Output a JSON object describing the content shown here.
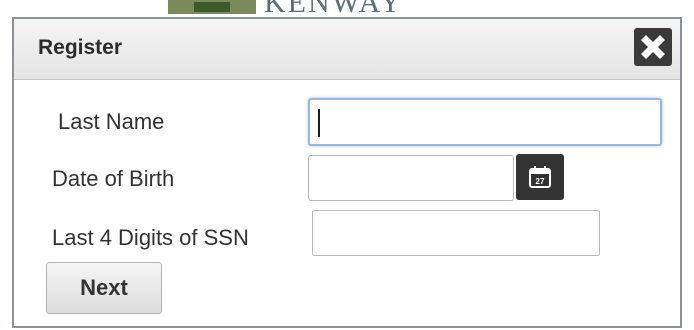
{
  "background": {
    "logo": {
      "wordmark": "KENWAY",
      "icon": "brand-logo-icon"
    }
  },
  "dialog": {
    "title": "Register",
    "close_icon": "close-icon",
    "fields": {
      "last_name": {
        "label": "Last Name",
        "value": ""
      },
      "date_of_birth": {
        "label": "Date of Birth",
        "value": "",
        "picker_icon": "calendar-icon",
        "picker_day": "27"
      },
      "ssn_last4": {
        "label": "Last 4 Digits of SSN",
        "value": ""
      }
    },
    "next_label": "Next"
  },
  "colors": {
    "title_bar": "#e9e9e9",
    "close_button": "#3a3a3a",
    "calendar_button": "#333333",
    "focus_border": "#9bb7d8",
    "dialog_border": "#8e9296"
  }
}
